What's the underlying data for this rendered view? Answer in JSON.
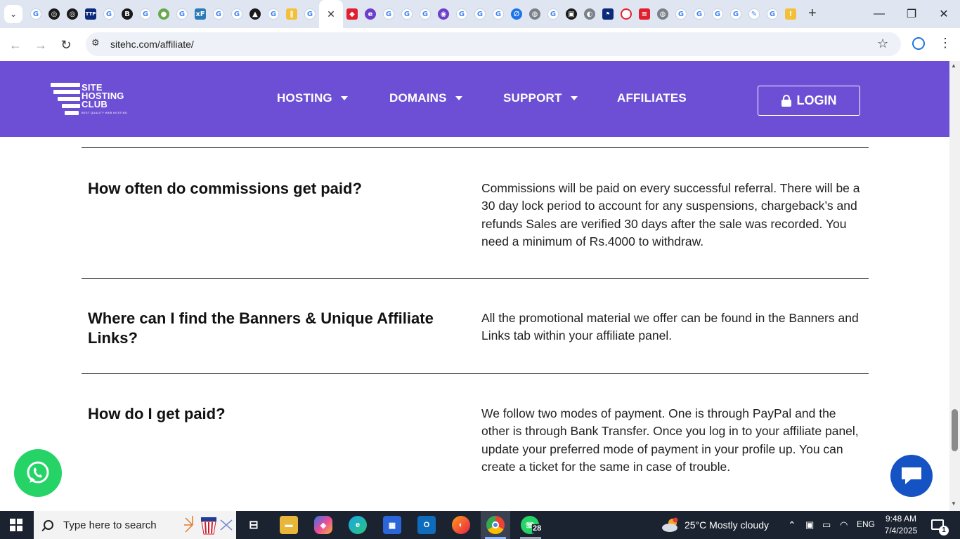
{
  "browser": {
    "active_tab_close": "✕",
    "new_tab": "+",
    "url": "sitehc.com/affiliate/",
    "window_controls": {
      "minimize": "—",
      "maximize": "❐",
      "close": "✕"
    }
  },
  "site": {
    "logo_lines": [
      "SITE",
      "HOSTING",
      "CLUB"
    ],
    "logo_tagline": "BEST QUALITY WEB HOSTING",
    "nav": [
      {
        "label": "HOSTING",
        "has_dropdown": true
      },
      {
        "label": "DOMAINS",
        "has_dropdown": true
      },
      {
        "label": "SUPPORT",
        "has_dropdown": true
      },
      {
        "label": "AFFILIATES",
        "has_dropdown": false
      }
    ],
    "login_label": "LOGIN",
    "brand_color": "#6c4fd5"
  },
  "faq": [
    {
      "question": "How often do commissions get paid?",
      "answer": "Commissions will be paid on every successful referral. There will be a 30 day lock period to account for any suspensions, chargeback’s and refunds Sales are verified 30 days after the sale was recorded. You need a minimum of Rs.4000 to withdraw."
    },
    {
      "question": "Where can I find the Banners & Unique Affiliate Links?",
      "answer": "All the promotional material we offer can be found in the Banners and Links tab within your affiliate panel."
    },
    {
      "question": "How do I get paid?",
      "answer": "We follow two modes of payment. One is through PayPal and the other is through Bank Transfer. Once you log in to your affiliate panel, update your preferred mode of payment in your profile up. You can create a ticket for the same in case of trouble."
    }
  ],
  "taskbar": {
    "search_placeholder": "Type here to search",
    "whatsapp_badge": "28",
    "weather": "25°C  Mostly cloudy",
    "language": "ENG",
    "time": "9:48 AM",
    "date": "7/4/2025",
    "notification_count": "1"
  }
}
